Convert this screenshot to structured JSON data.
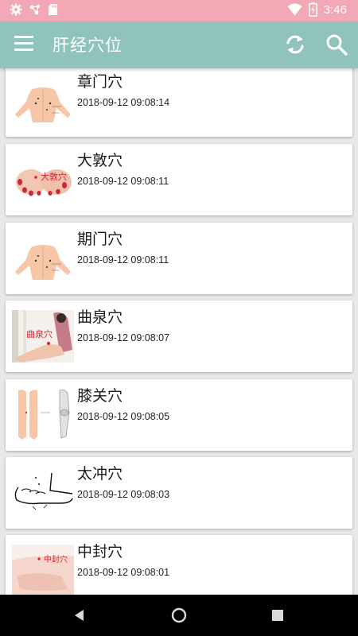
{
  "status_bar": {
    "time": "3:46",
    "icons": [
      "gear-icon",
      "nodes-icon",
      "sd-card-icon",
      "wifi-icon",
      "battery-charging-icon"
    ],
    "color": "#f2a9b5"
  },
  "app_bar": {
    "title": "肝经穴位",
    "color": "#91c3bd",
    "icons": [
      "menu-icon",
      "refresh-icon",
      "search-icon"
    ]
  },
  "items": [
    {
      "name": "章门穴",
      "time": "2018-09-12 09:08:14",
      "thumb": "torso-figure"
    },
    {
      "name": "大敦穴",
      "time": "2018-09-12 09:08:11",
      "thumb": "feet-photo"
    },
    {
      "name": "期门穴",
      "time": "2018-09-12 09:08:11",
      "thumb": "torso-figure"
    },
    {
      "name": "曲泉穴",
      "time": "2018-09-12 09:08:07",
      "thumb": "knee-photo"
    },
    {
      "name": "膝关穴",
      "time": "2018-09-12 09:08:05",
      "thumb": "legs-figure"
    },
    {
      "name": "太冲穴",
      "time": "2018-09-12 09:08:03",
      "thumb": "foot-sketch"
    },
    {
      "name": "中封穴",
      "time": "2018-09-12 09:08:01",
      "thumb": "ankle-photo"
    }
  ],
  "thumb_labels": {
    "feet": "大敦穴",
    "knee": "曲泉穴",
    "ankle": "中封穴"
  },
  "nav_bar": {
    "icons": [
      "back-icon",
      "home-icon",
      "recents-icon"
    ]
  }
}
